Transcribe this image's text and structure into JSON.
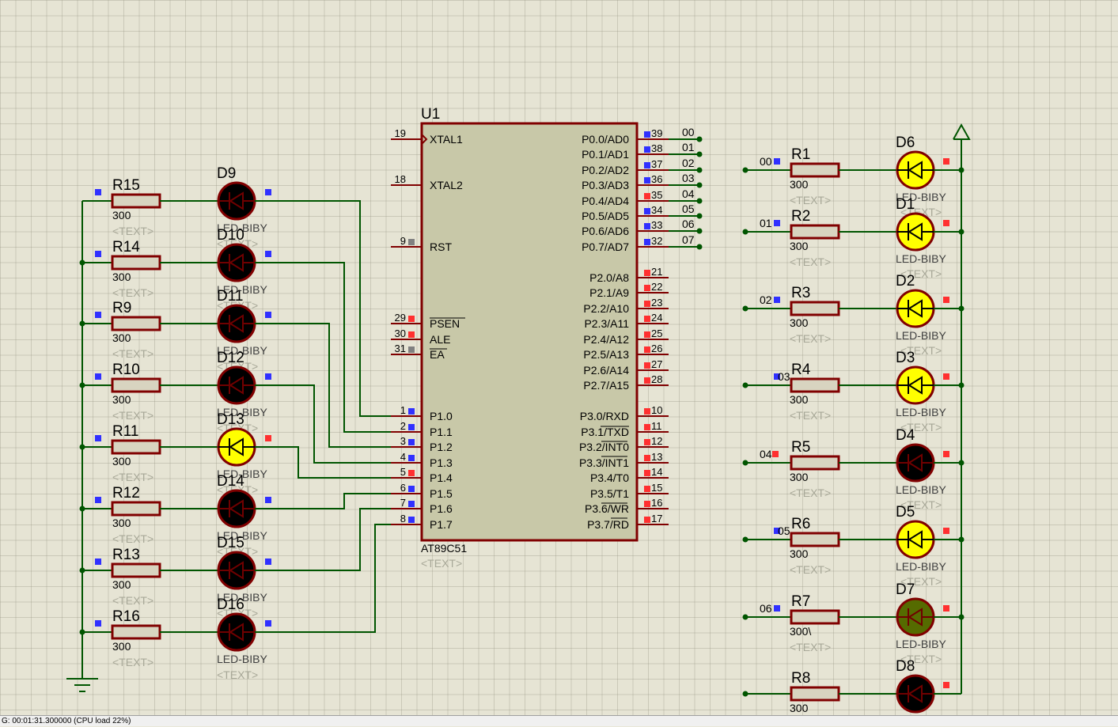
{
  "chip": {
    "ref": "U1",
    "part": "AT89C51",
    "text": "<TEXT>",
    "left_pins": [
      {
        "num": "19",
        "name": "XTAL1"
      },
      {
        "num": "18",
        "name": "XTAL2"
      },
      {
        "num": "9",
        "name": "RST"
      },
      {
        "num": "29",
        "name": "PSEN"
      },
      {
        "num": "30",
        "name": "ALE"
      },
      {
        "num": "31",
        "name": "EA"
      },
      {
        "num": "1",
        "name": "P1.0"
      },
      {
        "num": "2",
        "name": "P1.1"
      },
      {
        "num": "3",
        "name": "P1.2"
      },
      {
        "num": "4",
        "name": "P1.3"
      },
      {
        "num": "5",
        "name": "P1.4"
      },
      {
        "num": "6",
        "name": "P1.5"
      },
      {
        "num": "7",
        "name": "P1.6"
      },
      {
        "num": "8",
        "name": "P1.7"
      }
    ],
    "right_pins": [
      {
        "num": "39",
        "name": "P0.0/AD0",
        "net": "00"
      },
      {
        "num": "38",
        "name": "P0.1/AD1",
        "net": "01"
      },
      {
        "num": "37",
        "name": "P0.2/AD2",
        "net": "02"
      },
      {
        "num": "36",
        "name": "P0.3/AD3",
        "net": "03"
      },
      {
        "num": "35",
        "name": "P0.4/AD4",
        "net": "04"
      },
      {
        "num": "34",
        "name": "P0.5/AD5",
        "net": "05"
      },
      {
        "num": "33",
        "name": "P0.6/AD6",
        "net": "06"
      },
      {
        "num": "32",
        "name": "P0.7/AD7",
        "net": "07"
      },
      {
        "num": "21",
        "name": "P2.0/A8",
        "net": ""
      },
      {
        "num": "22",
        "name": "P2.1/A9",
        "net": ""
      },
      {
        "num": "23",
        "name": "P2.2/A10",
        "net": ""
      },
      {
        "num": "24",
        "name": "P2.3/A11",
        "net": ""
      },
      {
        "num": "25",
        "name": "P2.4/A12",
        "net": ""
      },
      {
        "num": "26",
        "name": "P2.5/A13",
        "net": ""
      },
      {
        "num": "27",
        "name": "P2.6/A14",
        "net": ""
      },
      {
        "num": "28",
        "name": "P2.7/A15",
        "net": ""
      },
      {
        "num": "10",
        "name": "P3.0/RXD",
        "net": ""
      },
      {
        "num": "11",
        "name": "P3.1/TXD",
        "net": ""
      },
      {
        "num": "12",
        "name": "P3.2/INT0",
        "net": ""
      },
      {
        "num": "13",
        "name": "P3.3/INT1",
        "net": ""
      },
      {
        "num": "14",
        "name": "P3.4/T0",
        "net": ""
      },
      {
        "num": "15",
        "name": "P3.5/T1",
        "net": ""
      },
      {
        "num": "16",
        "name": "P3.6/WR",
        "net": ""
      },
      {
        "num": "17",
        "name": "P3.7/RD",
        "net": ""
      }
    ]
  },
  "left_bank": [
    {
      "r": "R15",
      "rv": "300",
      "d": "D9",
      "dt": "LED-BIBY",
      "lit": false
    },
    {
      "r": "R14",
      "rv": "300",
      "d": "D10",
      "dt": "LED-BIBY",
      "lit": false
    },
    {
      "r": "R9",
      "rv": "300",
      "d": "D11",
      "dt": "LED-BIBY",
      "lit": false
    },
    {
      "r": "R10",
      "rv": "300",
      "d": "D12",
      "dt": "LED-BIBY",
      "lit": false
    },
    {
      "r": "R11",
      "rv": "300",
      "d": "D13",
      "dt": "LED-BIBY",
      "lit": true
    },
    {
      "r": "R12",
      "rv": "300",
      "d": "D14",
      "dt": "LED-BIBY",
      "lit": false
    },
    {
      "r": "R13",
      "rv": "300",
      "d": "D15",
      "dt": "LED-BIBY",
      "lit": false
    },
    {
      "r": "R16",
      "rv": "300",
      "d": "D16",
      "dt": "LED-BIBY",
      "lit": false
    }
  ],
  "right_bank": [
    {
      "net": "00",
      "r": "R1",
      "rv": "300",
      "d": "D6",
      "dt": "LED-BIBY",
      "state": "on"
    },
    {
      "net": "01",
      "r": "R2",
      "rv": "300",
      "d": "D1",
      "dt": "LED-BIBY",
      "state": "on"
    },
    {
      "net": "02",
      "r": "R3",
      "rv": "300",
      "d": "D2",
      "dt": "LED-BIBY",
      "state": "on"
    },
    {
      "net": "03",
      "r": "R4",
      "rv": "300",
      "d": "D3",
      "dt": "LED-BIBY",
      "state": "on"
    },
    {
      "net": "04",
      "r": "R5",
      "rv": "300",
      "d": "D4",
      "dt": "LED-BIBY",
      "state": "off"
    },
    {
      "net": "05",
      "r": "R6",
      "rv": "300",
      "d": "D5",
      "dt": "LED-BIBY",
      "state": "on"
    },
    {
      "net": "06",
      "r": "R7",
      "rv": "300\\",
      "d": "D7",
      "dt": "LED-BIBY",
      "state": "dim"
    },
    {
      "net": "",
      "r": "R8",
      "rv": "300",
      "d": "D8",
      "dt": "",
      "state": "off"
    }
  ],
  "text_placeholder": "<TEXT>",
  "status_text": "G: 00:01:31.300000 (CPU load 22%)",
  "colors": {
    "wire": "#005500",
    "body": "#800000",
    "chip_fill": "#c8c8a8",
    "resistor_fill": "#d8d4c0",
    "led_on": "#ffff00",
    "led_off": "#000000",
    "led_dim": "#556b00",
    "pin_high": "#ff3030",
    "pin_low": "#3030ff",
    "pin_float": "#808080",
    "ghost": "#a8a898"
  }
}
